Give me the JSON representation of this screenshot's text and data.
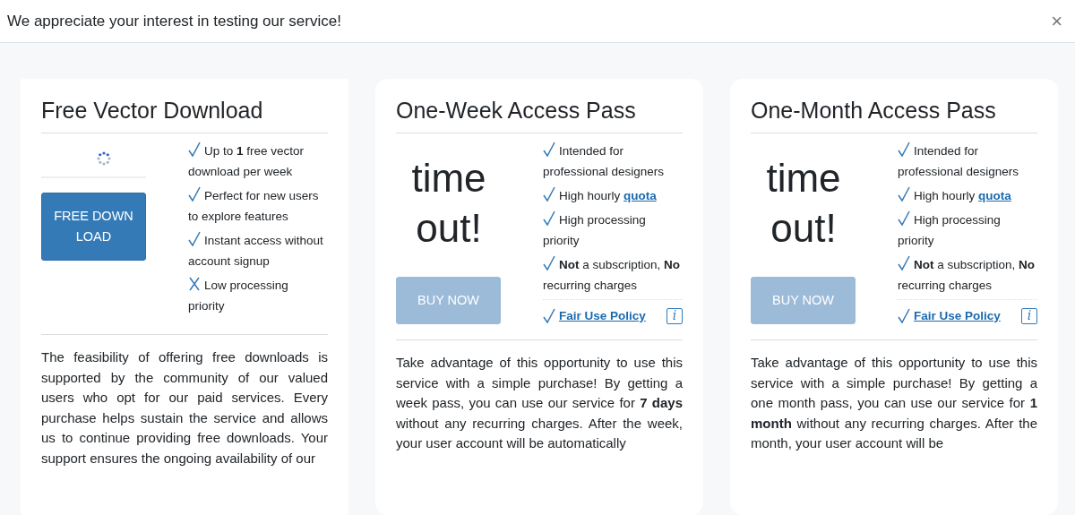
{
  "dialog": {
    "title": "We appreciate your interest in testing our service!",
    "close": "×"
  },
  "cards": [
    {
      "kind": "free",
      "title": "Free Vector Download",
      "visual": {
        "kind": "spinner"
      },
      "button": {
        "label": "FREE DOWN LOAD",
        "disabled": false
      },
      "features": [
        {
          "kind": "check",
          "text": "Up to **1** free vector download per week"
        },
        {
          "kind": "check",
          "text": "Perfect for new users to explore features"
        },
        {
          "kind": "check",
          "text": "Instant access without account signup"
        },
        {
          "kind": "cross",
          "text": "Low processing priority"
        }
      ],
      "description": "The feasibility of offering free downloads is supported by the community of our valued users who opt for our paid services. Every purchase helps sustain the service and allows us to continue providing free downloads. Your support ensures the ongoing availability of our"
    },
    {
      "kind": "pass",
      "title": "One-Week Access Pass",
      "visual": {
        "kind": "message",
        "text": "time out!"
      },
      "button": {
        "label": "BUY NOW",
        "disabled": true
      },
      "features": [
        {
          "kind": "check",
          "text": "Intended for professional designers"
        },
        {
          "kind": "check",
          "text": "High hourly ",
          "link": "quota"
        },
        {
          "kind": "check",
          "text": "High processing priority"
        },
        {
          "kind": "check",
          "text": "**Not** a subscription, **No** recurring charges"
        },
        {
          "kind": "policy",
          "link": "Fair Use Policy",
          "info": "i"
        }
      ],
      "description": "Take advantage of this opportunity to use this service with a simple purchase! By getting a week pass, you can use our service for **7 days** without any recurring charges. After the week, your user account will be automatically"
    },
    {
      "kind": "pass",
      "title": "One-Month Access Pass",
      "visual": {
        "kind": "message",
        "text": "time out!"
      },
      "button": {
        "label": "BUY NOW",
        "disabled": true
      },
      "features": [
        {
          "kind": "check",
          "text": "Intended for professional designers"
        },
        {
          "kind": "check",
          "text": "High hourly ",
          "link": "quota"
        },
        {
          "kind": "check",
          "text": "High processing priority"
        },
        {
          "kind": "check",
          "text": "**Not** a subscription, **No** recurring charges"
        },
        {
          "kind": "policy",
          "link": "Fair Use Policy",
          "info": "i"
        }
      ],
      "description": "Take advantage of this opportunity to use this service with a simple purchase! By getting a one month pass, you can use our service for **1 month** without any recurring charges. After the month, your user account will be"
    }
  ]
}
